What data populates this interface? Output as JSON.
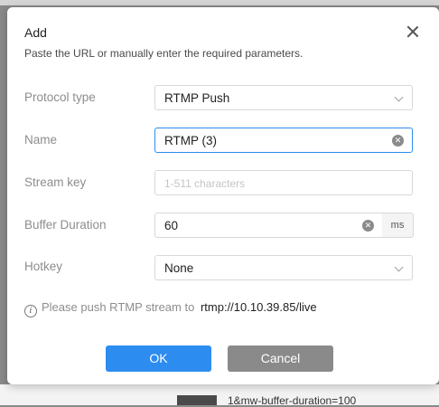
{
  "dialog": {
    "title": "Add",
    "subtitle": "Paste the URL or manually enter the required parameters."
  },
  "form": {
    "protocol_type": {
      "label": "Protocol type",
      "value": "RTMP Push"
    },
    "name": {
      "label": "Name",
      "value": "RTMP (3)"
    },
    "stream_key": {
      "label": "Stream key",
      "placeholder": "1-511 characters"
    },
    "buffer_duration": {
      "label": "Buffer Duration",
      "value": "60",
      "unit": "ms"
    },
    "hotkey": {
      "label": "Hotkey",
      "value": "None"
    }
  },
  "info": {
    "text": "Please push RTMP stream to",
    "url": "rtmp://10.10.39.85/live"
  },
  "buttons": {
    "ok": "OK",
    "cancel": "Cancel"
  },
  "background": {
    "snippet": "1&mw-buffer-duration=100"
  },
  "colors": {
    "accent": "#2d8cf0",
    "cancel": "#8a8a8a"
  }
}
